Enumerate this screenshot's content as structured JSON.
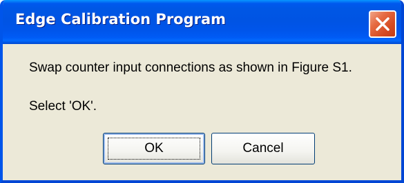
{
  "window": {
    "title": "Edge Calibration Program",
    "close_icon": "close-icon",
    "titlebar_color": "#0054e3",
    "body_color": "#ece9d8",
    "close_color": "#d54b22"
  },
  "message": {
    "line1": "Swap counter input connections as shown in Figure S1.",
    "line2": "Select 'OK'."
  },
  "buttons": {
    "ok_label": "OK",
    "cancel_label": "Cancel"
  }
}
